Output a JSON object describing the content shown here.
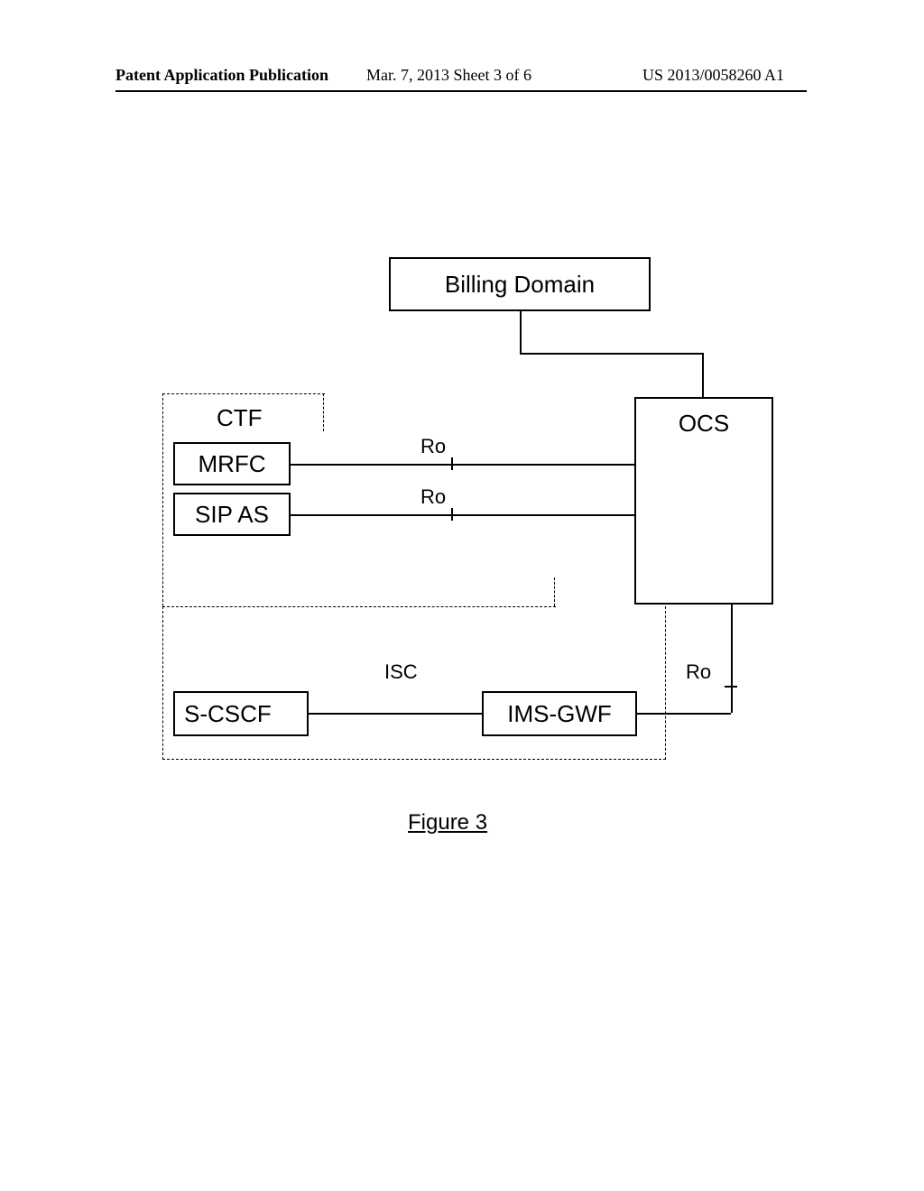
{
  "header": {
    "left": "Patent Application Publication",
    "center": "Mar. 7, 2013  Sheet 3 of 6",
    "right": "US 2013/0058260 A1"
  },
  "diagram": {
    "billing_domain": "Billing Domain",
    "ctf": "CTF",
    "mrfc": "MRFC",
    "sip_as": "SIP AS",
    "ocs": "OCS",
    "s_cscf": "S-CSCF",
    "ims_gwf": "IMS-GWF",
    "ro1": "Ro",
    "ro2": "Ro",
    "ro3": "Ro",
    "isc": "ISC",
    "figure_caption": "Figure 3"
  }
}
